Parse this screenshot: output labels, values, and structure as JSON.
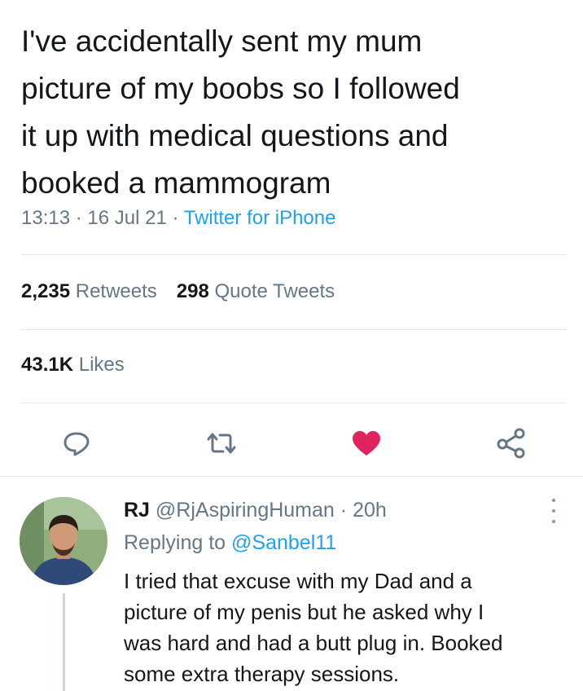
{
  "tweet": {
    "text": "I've accidentally sent my mum\npicture of my boobs so I followed\nit up with medical questions and\nbooked a mammogram",
    "time": "13:13",
    "separator": "·",
    "date": "16 Jul 21",
    "source": "Twitter for iPhone"
  },
  "stats": {
    "retweets_count": "2,235",
    "retweets_label": "Retweets",
    "quote_count": "298",
    "quote_label": "Quote Tweets",
    "likes_count": "43.1K",
    "likes_label": "Likes"
  },
  "actions": {
    "icons": [
      "reply-icon",
      "retweet-icon",
      "like-icon",
      "share-icon"
    ],
    "like_color": "#e0245e",
    "icon_color": "#657786"
  },
  "reply": {
    "display_name": "RJ",
    "handle": "@RjAspiringHuman",
    "separator": "·",
    "age": "20h",
    "replying_prefix": "Replying to",
    "replying_to": "@Sanbel11",
    "text": "I tried that excuse with my Dad and a\npicture of my penis but he asked why I\nwas hard and had a butt plug in. Booked\nsome extra therapy sessions."
  },
  "colors": {
    "link": "#1da1f2",
    "secondary_text": "#657786",
    "divider": "#e1e8ed"
  }
}
